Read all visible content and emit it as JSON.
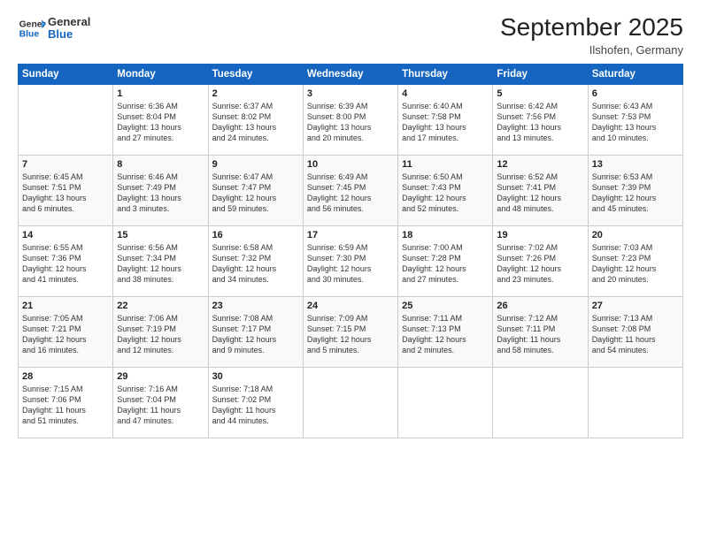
{
  "logo": {
    "line1": "General",
    "line2": "Blue"
  },
  "title": "September 2025",
  "location": "Ilshofen, Germany",
  "days_header": [
    "Sunday",
    "Monday",
    "Tuesday",
    "Wednesday",
    "Thursday",
    "Friday",
    "Saturday"
  ],
  "weeks": [
    [
      {
        "day": "",
        "info": ""
      },
      {
        "day": "1",
        "info": "Sunrise: 6:36 AM\nSunset: 8:04 PM\nDaylight: 13 hours\nand 27 minutes."
      },
      {
        "day": "2",
        "info": "Sunrise: 6:37 AM\nSunset: 8:02 PM\nDaylight: 13 hours\nand 24 minutes."
      },
      {
        "day": "3",
        "info": "Sunrise: 6:39 AM\nSunset: 8:00 PM\nDaylight: 13 hours\nand 20 minutes."
      },
      {
        "day": "4",
        "info": "Sunrise: 6:40 AM\nSunset: 7:58 PM\nDaylight: 13 hours\nand 17 minutes."
      },
      {
        "day": "5",
        "info": "Sunrise: 6:42 AM\nSunset: 7:56 PM\nDaylight: 13 hours\nand 13 minutes."
      },
      {
        "day": "6",
        "info": "Sunrise: 6:43 AM\nSunset: 7:53 PM\nDaylight: 13 hours\nand 10 minutes."
      }
    ],
    [
      {
        "day": "7",
        "info": "Sunrise: 6:45 AM\nSunset: 7:51 PM\nDaylight: 13 hours\nand 6 minutes."
      },
      {
        "day": "8",
        "info": "Sunrise: 6:46 AM\nSunset: 7:49 PM\nDaylight: 13 hours\nand 3 minutes."
      },
      {
        "day": "9",
        "info": "Sunrise: 6:47 AM\nSunset: 7:47 PM\nDaylight: 12 hours\nand 59 minutes."
      },
      {
        "day": "10",
        "info": "Sunrise: 6:49 AM\nSunset: 7:45 PM\nDaylight: 12 hours\nand 56 minutes."
      },
      {
        "day": "11",
        "info": "Sunrise: 6:50 AM\nSunset: 7:43 PM\nDaylight: 12 hours\nand 52 minutes."
      },
      {
        "day": "12",
        "info": "Sunrise: 6:52 AM\nSunset: 7:41 PM\nDaylight: 12 hours\nand 48 minutes."
      },
      {
        "day": "13",
        "info": "Sunrise: 6:53 AM\nSunset: 7:39 PM\nDaylight: 12 hours\nand 45 minutes."
      }
    ],
    [
      {
        "day": "14",
        "info": "Sunrise: 6:55 AM\nSunset: 7:36 PM\nDaylight: 12 hours\nand 41 minutes."
      },
      {
        "day": "15",
        "info": "Sunrise: 6:56 AM\nSunset: 7:34 PM\nDaylight: 12 hours\nand 38 minutes."
      },
      {
        "day": "16",
        "info": "Sunrise: 6:58 AM\nSunset: 7:32 PM\nDaylight: 12 hours\nand 34 minutes."
      },
      {
        "day": "17",
        "info": "Sunrise: 6:59 AM\nSunset: 7:30 PM\nDaylight: 12 hours\nand 30 minutes."
      },
      {
        "day": "18",
        "info": "Sunrise: 7:00 AM\nSunset: 7:28 PM\nDaylight: 12 hours\nand 27 minutes."
      },
      {
        "day": "19",
        "info": "Sunrise: 7:02 AM\nSunset: 7:26 PM\nDaylight: 12 hours\nand 23 minutes."
      },
      {
        "day": "20",
        "info": "Sunrise: 7:03 AM\nSunset: 7:23 PM\nDaylight: 12 hours\nand 20 minutes."
      }
    ],
    [
      {
        "day": "21",
        "info": "Sunrise: 7:05 AM\nSunset: 7:21 PM\nDaylight: 12 hours\nand 16 minutes."
      },
      {
        "day": "22",
        "info": "Sunrise: 7:06 AM\nSunset: 7:19 PM\nDaylight: 12 hours\nand 12 minutes."
      },
      {
        "day": "23",
        "info": "Sunrise: 7:08 AM\nSunset: 7:17 PM\nDaylight: 12 hours\nand 9 minutes."
      },
      {
        "day": "24",
        "info": "Sunrise: 7:09 AM\nSunset: 7:15 PM\nDaylight: 12 hours\nand 5 minutes."
      },
      {
        "day": "25",
        "info": "Sunrise: 7:11 AM\nSunset: 7:13 PM\nDaylight: 12 hours\nand 2 minutes."
      },
      {
        "day": "26",
        "info": "Sunrise: 7:12 AM\nSunset: 7:11 PM\nDaylight: 11 hours\nand 58 minutes."
      },
      {
        "day": "27",
        "info": "Sunrise: 7:13 AM\nSunset: 7:08 PM\nDaylight: 11 hours\nand 54 minutes."
      }
    ],
    [
      {
        "day": "28",
        "info": "Sunrise: 7:15 AM\nSunset: 7:06 PM\nDaylight: 11 hours\nand 51 minutes."
      },
      {
        "day": "29",
        "info": "Sunrise: 7:16 AM\nSunset: 7:04 PM\nDaylight: 11 hours\nand 47 minutes."
      },
      {
        "day": "30",
        "info": "Sunrise: 7:18 AM\nSunset: 7:02 PM\nDaylight: 11 hours\nand 44 minutes."
      },
      {
        "day": "",
        "info": ""
      },
      {
        "day": "",
        "info": ""
      },
      {
        "day": "",
        "info": ""
      },
      {
        "day": "",
        "info": ""
      }
    ]
  ]
}
